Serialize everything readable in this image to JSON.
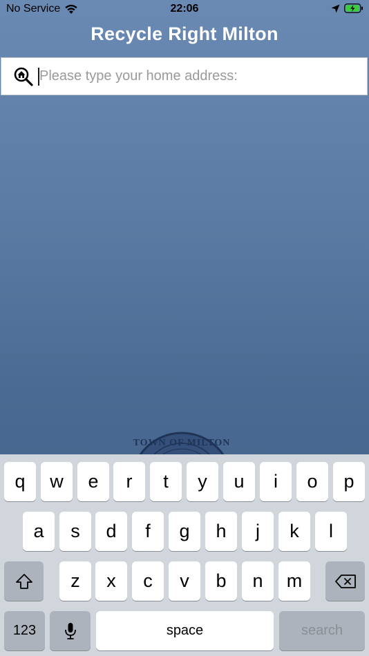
{
  "status_bar": {
    "carrier": "No Service",
    "time": "22:06"
  },
  "app": {
    "title": "Recycle Right Milton"
  },
  "search": {
    "placeholder": "Please type your home address:",
    "icon": "home-search-icon"
  },
  "keyboard": {
    "row1": [
      "q",
      "w",
      "e",
      "r",
      "t",
      "y",
      "u",
      "i",
      "o",
      "p"
    ],
    "row2": [
      "a",
      "s",
      "d",
      "f",
      "g",
      "h",
      "j",
      "k",
      "l"
    ],
    "row3": [
      "z",
      "x",
      "c",
      "v",
      "b",
      "n",
      "m"
    ],
    "numbers_label": "123",
    "space_label": "space",
    "search_label": "search"
  }
}
